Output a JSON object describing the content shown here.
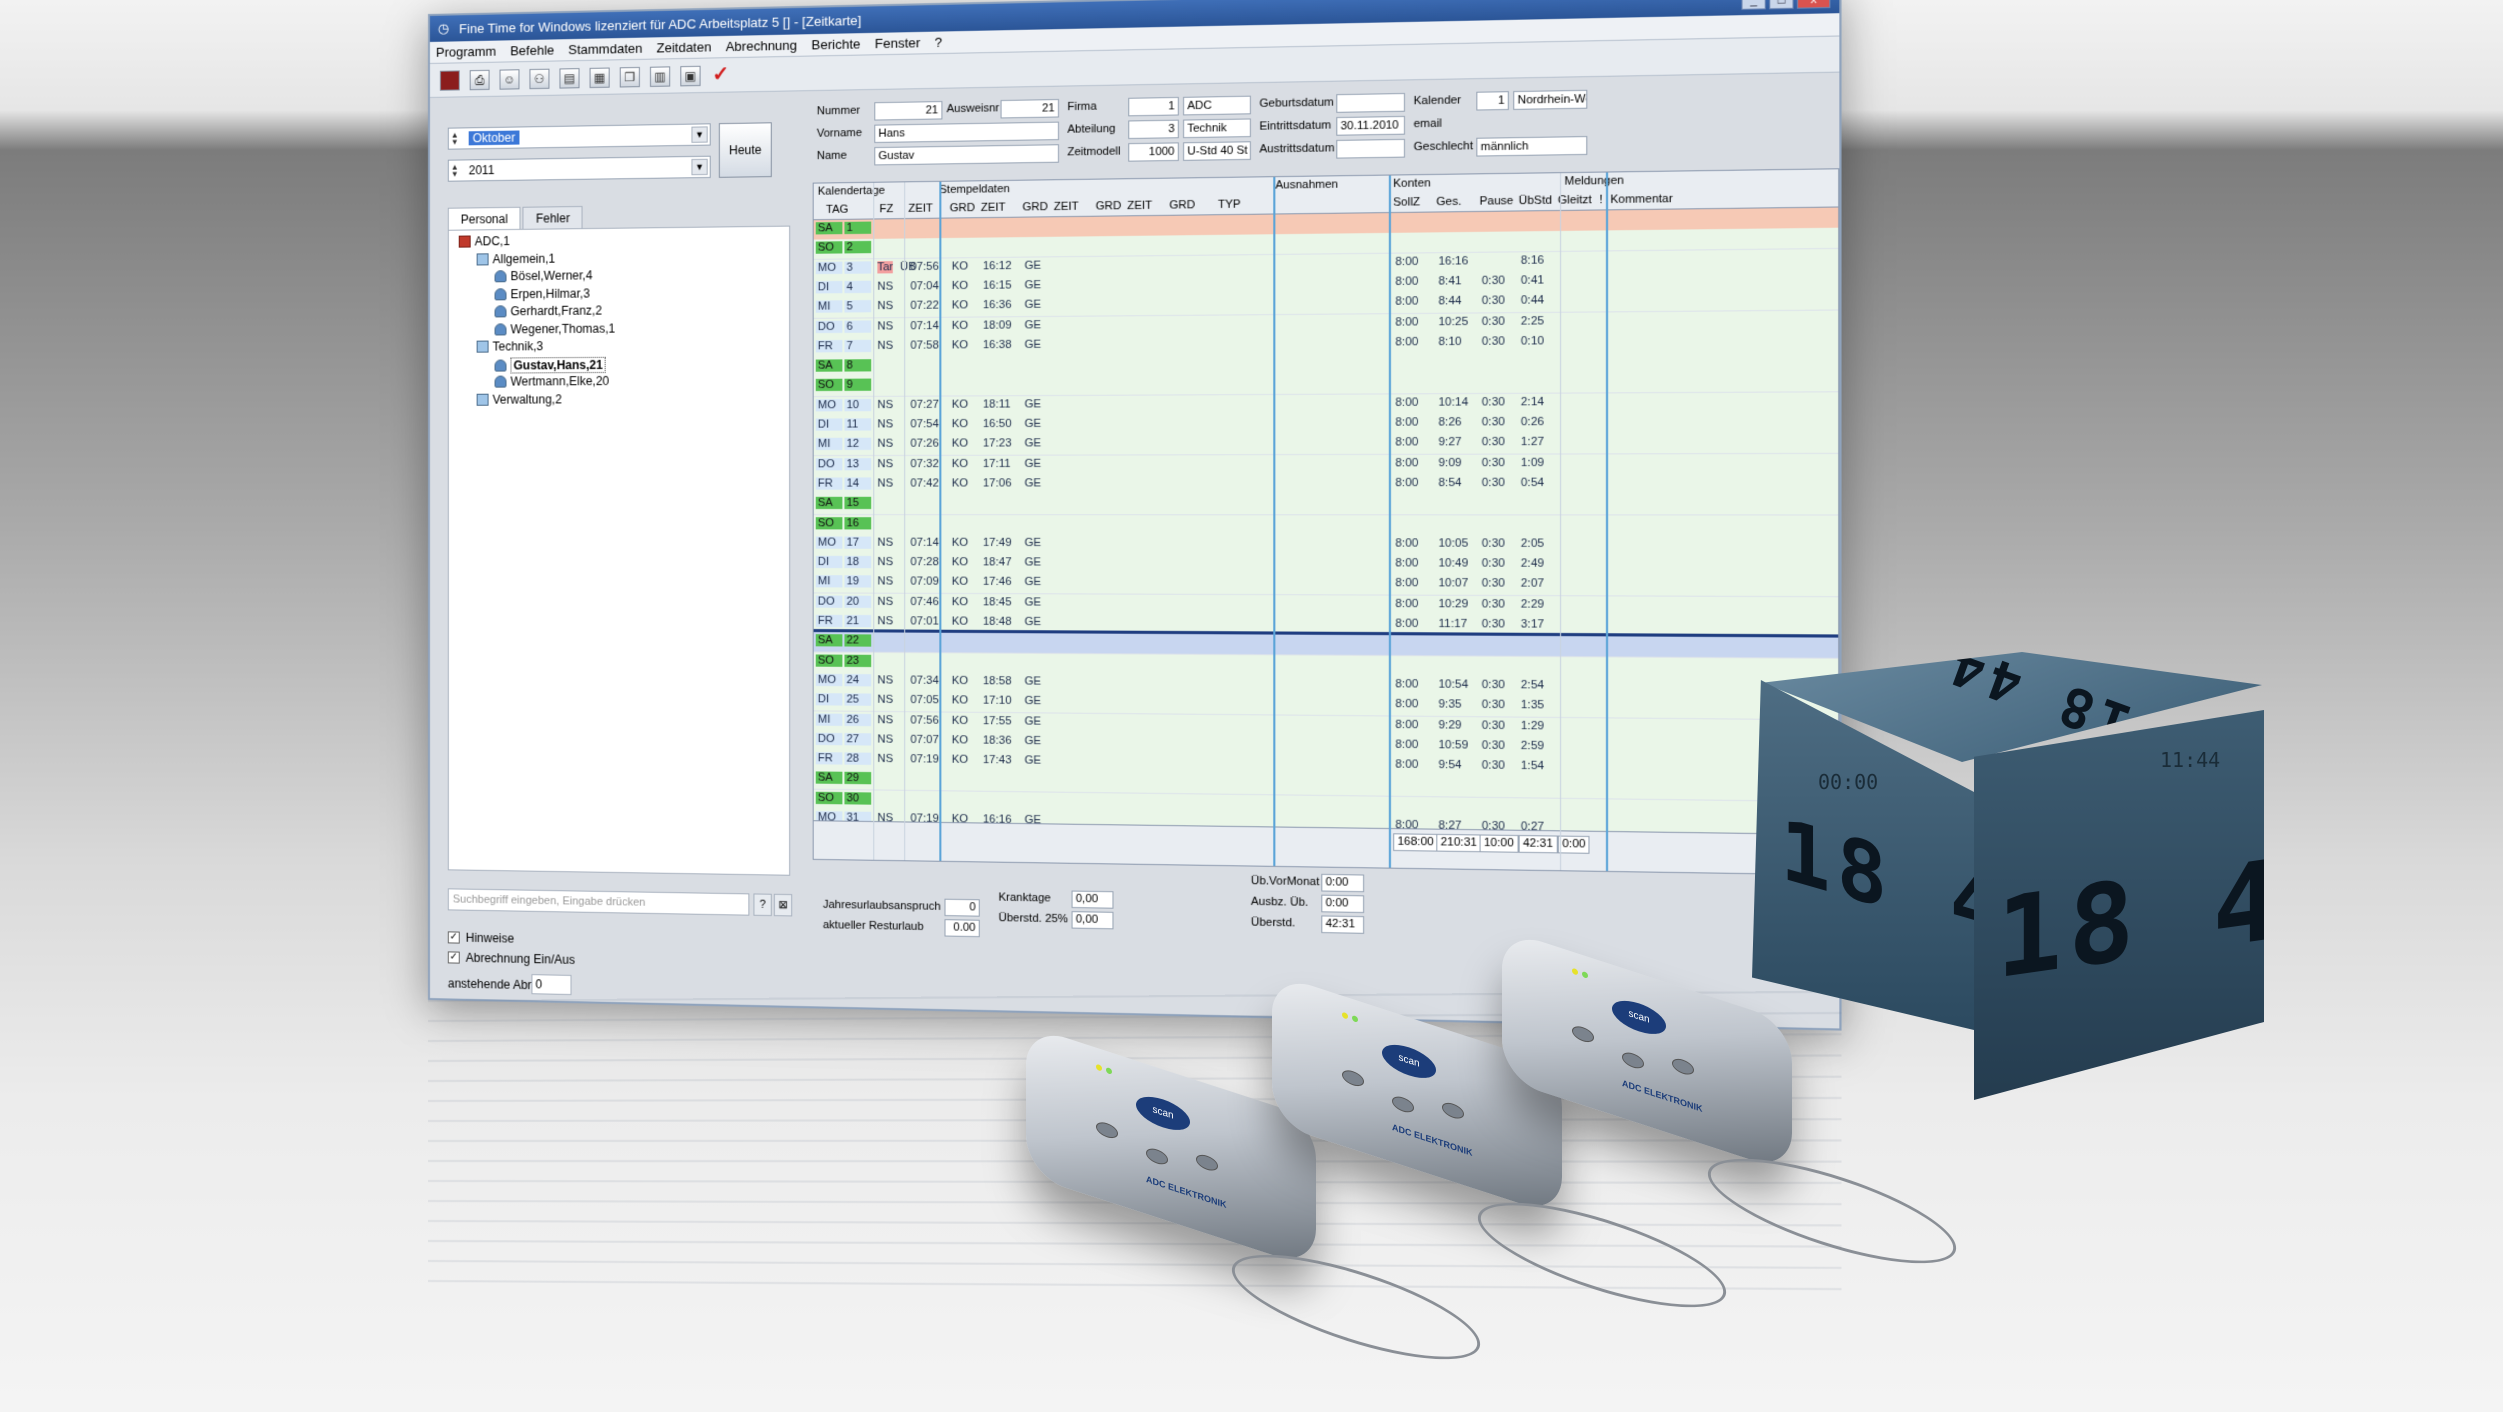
{
  "window": {
    "title": "Fine Time for Windows lizenziert für ADC    Arbeitsplatz 5 [] - [Zeitkarte]",
    "controls": [
      "_",
      "□",
      "x"
    ]
  },
  "menu": [
    "Programm",
    "Befehle",
    "Stammdaten",
    "Zeitdaten",
    "Abrechnung",
    "Berichte",
    "Fenster",
    "?"
  ],
  "toolbar": {
    "icons": [
      "exit-icon",
      "print-icon",
      "person-icon",
      "group-icon",
      "page-icon",
      "document-icon",
      "copy-icon",
      "calculator-icon",
      "save-icon",
      "checkmark-icon"
    ]
  },
  "selectors": {
    "month": "Oktober",
    "year": "2011",
    "today_button": "Heute"
  },
  "left_tabs": [
    "Personal",
    "Fehler"
  ],
  "tree": [
    {
      "label": "ADC,1",
      "level": 0,
      "kind": "root"
    },
    {
      "label": "Allgemein,1",
      "level": 1,
      "kind": "group"
    },
    {
      "label": "Bösel,Werner,4",
      "level": 2,
      "kind": "person"
    },
    {
      "label": "Erpen,Hilmar,3",
      "level": 2,
      "kind": "person"
    },
    {
      "label": "Gerhardt,Franz,2",
      "level": 2,
      "kind": "person"
    },
    {
      "label": "Wegener,Thomas,1",
      "level": 2,
      "kind": "person"
    },
    {
      "label": "Technik,3",
      "level": 1,
      "kind": "group"
    },
    {
      "label": "Gustav,Hans,21",
      "level": 2,
      "kind": "person",
      "selected": true
    },
    {
      "label": "Wertmann,Elke,20",
      "level": 2,
      "kind": "person"
    },
    {
      "label": "Verwaltung,2",
      "level": 1,
      "kind": "group"
    }
  ],
  "search": {
    "placeholder": "Suchbegriff eingeben, Eingabe drücken",
    "help": "?",
    "clear": "⊠"
  },
  "options": {
    "hinweise": "Hinweise",
    "abrechnung": "Abrechnung Ein/Aus",
    "anstehende_label": "anstehende Abr.",
    "anstehende_value": "0"
  },
  "employee": {
    "nummer_label": "Nummer",
    "nummer": "21",
    "ausweis_label": "Ausweisnr",
    "ausweis": "21",
    "vorname_label": "Vorname",
    "vorname": "Hans",
    "name_label": "Name",
    "name": "Gustav",
    "firma_label": "Firma",
    "firma_nr": "1",
    "firma": "ADC",
    "abteilung_label": "Abteilung",
    "abteilung_nr": "3",
    "abteilung": "Technik",
    "zeitmodell_label": "Zeitmodell",
    "zeitmodell_nr": "1000",
    "zeitmodell": "U-Std 40 St",
    "geburtsdatum_label": "Geburtsdatum",
    "geburtsdatum": "",
    "eintritt_label": "Eintrittsdatum",
    "eintritt": "30.11.2010",
    "austritt_label": "Austrittsdatum",
    "austritt": "",
    "kalender_label": "Kalender",
    "kalender_nr": "1",
    "kalender": "Nordrhein-We",
    "email_label": "email",
    "email": "",
    "geschlecht_label": "Geschlecht",
    "geschlecht": "männlich"
  },
  "grid": {
    "groups": [
      "Kalendertage",
      "Stempeldaten",
      "Ausnahmen",
      "Konten",
      "Meldungen"
    ],
    "columns": [
      "TAG",
      "FZ",
      "ZEIT",
      "GRD",
      "ZEIT",
      "GRD",
      "ZEIT",
      "GRD",
      "ZEIT",
      "GRD",
      "TYP",
      "SollZ",
      "Ges.",
      "Pause",
      "ÜbStd",
      "Gleitzt",
      "!",
      "Kommentar"
    ],
    "rows": [
      {
        "wd": "SA",
        "d": "1",
        "we": true,
        "first": true
      },
      {
        "wd": "SO",
        "d": "2",
        "we": true
      },
      {
        "wd": "MO",
        "d": "3",
        "fz": "Tar",
        "typ": "ÜB",
        "in": "07:56",
        "ig": "KO",
        "out": "16:12",
        "og": "GE",
        "soll": "8:00",
        "ges": "16:16",
        "pause": "",
        "ub": "8:16"
      },
      {
        "wd": "DI",
        "d": "4",
        "fz": "NS",
        "in": "07:04",
        "ig": "KO",
        "out": "16:15",
        "og": "GE",
        "soll": "8:00",
        "ges": "8:41",
        "pause": "0:30",
        "ub": "0:41"
      },
      {
        "wd": "MI",
        "d": "5",
        "fz": "NS",
        "in": "07:22",
        "ig": "KO",
        "out": "16:36",
        "og": "GE",
        "soll": "8:00",
        "ges": "8:44",
        "pause": "0:30",
        "ub": "0:44"
      },
      {
        "wd": "DO",
        "d": "6",
        "fz": "NS",
        "in": "07:14",
        "ig": "KO",
        "out": "18:09",
        "og": "GE",
        "soll": "8:00",
        "ges": "10:25",
        "pause": "0:30",
        "ub": "2:25"
      },
      {
        "wd": "FR",
        "d": "7",
        "fz": "NS",
        "in": "07:58",
        "ig": "KO",
        "out": "16:38",
        "og": "GE",
        "soll": "8:00",
        "ges": "8:10",
        "pause": "0:30",
        "ub": "0:10"
      },
      {
        "wd": "SA",
        "d": "8",
        "we": true
      },
      {
        "wd": "SO",
        "d": "9",
        "we": true
      },
      {
        "wd": "MO",
        "d": "10",
        "fz": "NS",
        "in": "07:27",
        "ig": "KO",
        "out": "18:11",
        "og": "GE",
        "soll": "8:00",
        "ges": "10:14",
        "pause": "0:30",
        "ub": "2:14"
      },
      {
        "wd": "DI",
        "d": "11",
        "fz": "NS",
        "in": "07:54",
        "ig": "KO",
        "out": "16:50",
        "og": "GE",
        "soll": "8:00",
        "ges": "8:26",
        "pause": "0:30",
        "ub": "0:26"
      },
      {
        "wd": "MI",
        "d": "12",
        "fz": "NS",
        "in": "07:26",
        "ig": "KO",
        "out": "17:23",
        "og": "GE",
        "soll": "8:00",
        "ges": "9:27",
        "pause": "0:30",
        "ub": "1:27"
      },
      {
        "wd": "DO",
        "d": "13",
        "fz": "NS",
        "in": "07:32",
        "ig": "KO",
        "out": "17:11",
        "og": "GE",
        "soll": "8:00",
        "ges": "9:09",
        "pause": "0:30",
        "ub": "1:09"
      },
      {
        "wd": "FR",
        "d": "14",
        "fz": "NS",
        "in": "07:42",
        "ig": "KO",
        "out": "17:06",
        "og": "GE",
        "soll": "8:00",
        "ges": "8:54",
        "pause": "0:30",
        "ub": "0:54"
      },
      {
        "wd": "SA",
        "d": "15",
        "we": true
      },
      {
        "wd": "SO",
        "d": "16",
        "we": true
      },
      {
        "wd": "MO",
        "d": "17",
        "fz": "NS",
        "in": "07:14",
        "ig": "KO",
        "out": "17:49",
        "og": "GE",
        "soll": "8:00",
        "ges": "10:05",
        "pause": "0:30",
        "ub": "2:05"
      },
      {
        "wd": "DI",
        "d": "18",
        "fz": "NS",
        "in": "07:28",
        "ig": "KO",
        "out": "18:47",
        "og": "GE",
        "soll": "8:00",
        "ges": "10:49",
        "pause": "0:30",
        "ub": "2:49"
      },
      {
        "wd": "MI",
        "d": "19",
        "fz": "NS",
        "in": "07:09",
        "ig": "KO",
        "out": "17:46",
        "og": "GE",
        "soll": "8:00",
        "ges": "10:07",
        "pause": "0:30",
        "ub": "2:07"
      },
      {
        "wd": "DO",
        "d": "20",
        "fz": "NS",
        "in": "07:46",
        "ig": "KO",
        "out": "18:45",
        "og": "GE",
        "soll": "8:00",
        "ges": "10:29",
        "pause": "0:30",
        "ub": "2:29"
      },
      {
        "wd": "FR",
        "d": "21",
        "fz": "NS",
        "in": "07:01",
        "ig": "KO",
        "out": "18:48",
        "og": "GE",
        "soll": "8:00",
        "ges": "11:17",
        "pause": "0:30",
        "ub": "3:17"
      },
      {
        "wd": "SA",
        "d": "22",
        "we": true,
        "selected": true
      },
      {
        "wd": "SO",
        "d": "23",
        "we": true
      },
      {
        "wd": "MO",
        "d": "24",
        "fz": "NS",
        "in": "07:34",
        "ig": "KO",
        "out": "18:58",
        "og": "GE",
        "soll": "8:00",
        "ges": "10:54",
        "pause": "0:30",
        "ub": "2:54"
      },
      {
        "wd": "DI",
        "d": "25",
        "fz": "NS",
        "in": "07:05",
        "ig": "KO",
        "out": "17:10",
        "og": "GE",
        "soll": "8:00",
        "ges": "9:35",
        "pause": "0:30",
        "ub": "1:35"
      },
      {
        "wd": "MI",
        "d": "26",
        "fz": "NS",
        "in": "07:56",
        "ig": "KO",
        "out": "17:55",
        "og": "GE",
        "soll": "8:00",
        "ges": "9:29",
        "pause": "0:30",
        "ub": "1:29"
      },
      {
        "wd": "DO",
        "d": "27",
        "fz": "NS",
        "in": "07:07",
        "ig": "KO",
        "out": "18:36",
        "og": "GE",
        "soll": "8:00",
        "ges": "10:59",
        "pause": "0:30",
        "ub": "2:59"
      },
      {
        "wd": "FR",
        "d": "28",
        "fz": "NS",
        "in": "07:19",
        "ig": "KO",
        "out": "17:43",
        "og": "GE",
        "soll": "8:00",
        "ges": "9:54",
        "pause": "0:30",
        "ub": "1:54"
      },
      {
        "wd": "SA",
        "d": "29",
        "we": true
      },
      {
        "wd": "SO",
        "d": "30",
        "we": true
      },
      {
        "wd": "MO",
        "d": "31",
        "fz": "NS",
        "in": "07:19",
        "ig": "KO",
        "out": "16:16",
        "og": "GE",
        "soll": "8:00",
        "ges": "8:27",
        "pause": "0:30",
        "ub": "0:27"
      }
    ],
    "totals": {
      "soll": "168:00",
      "ges": "210:31",
      "pause": "10:00",
      "ub": "42:31",
      "gleit": "0:00"
    }
  },
  "summary": {
    "urlaub_label": "Jahresurlaubsanspruch",
    "urlaub": "0",
    "rest_label": "aktueller Resturlaub",
    "rest": "0.00",
    "krank_label": "Kranktage",
    "krank": "0,00",
    "ueberstd25_label": "Überstd. 25%",
    "ueberstd25": "0,00",
    "vormonat_label": "Üb.VorMonat",
    "vormonat": "0:00",
    "ausbz_label": "Ausbz. Üb.",
    "ausbz": "0:00",
    "ueberstd_label": "Überstd.",
    "ueberstd": "42:31"
  },
  "cube": {
    "display": "18 44",
    "small_display_1": "00:00",
    "small_display_2": "11:44"
  },
  "devices": {
    "button_label": "scan",
    "brand": "ADC ELEKTRONIK",
    "count": 3
  }
}
